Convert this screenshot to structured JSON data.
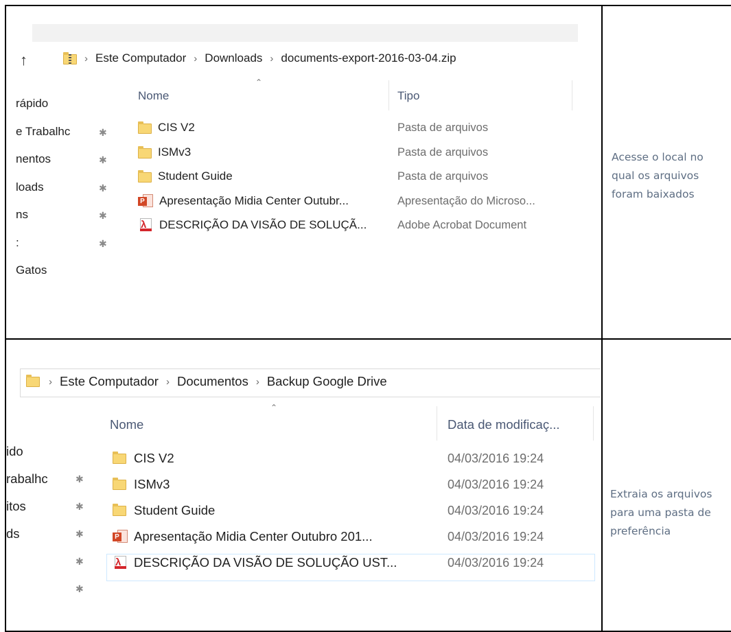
{
  "shot1": {
    "breadcrumb": [
      "Este Computador",
      "Downloads",
      "documents-export-2016-03-04.zip"
    ],
    "sep": "›",
    "columns": {
      "name": "Nome",
      "second": "Tipo"
    },
    "nav": [
      {
        "label": "rápido",
        "pinned": false
      },
      {
        "label": "e Trabalhc",
        "pinned": true
      },
      {
        "label": "nentos",
        "pinned": true
      },
      {
        "label": "loads",
        "pinned": true
      },
      {
        "label": "ns",
        "pinned": true
      },
      {
        "label": ":",
        "pinned": true
      },
      {
        "label": "Gatos",
        "pinned": false
      }
    ],
    "files": [
      {
        "icon": "folder-icon",
        "name": "CIS V2",
        "second": "Pasta de arquivos"
      },
      {
        "icon": "folder-icon",
        "name": "ISMv3",
        "second": "Pasta de arquivos"
      },
      {
        "icon": "folder-icon",
        "name": "Student Guide",
        "second": "Pasta de arquivos"
      },
      {
        "icon": "powerpoint-icon",
        "name": "Apresentação Midia Center Outubr...",
        "second": "Apresentação do Microso..."
      },
      {
        "icon": "pdf-icon",
        "name": "DESCRIÇÃO DA VISÃO DE SOLUÇÃ...",
        "second": "Adobe Acrobat Document"
      }
    ]
  },
  "caption1": [
    "Acesse o local no",
    "qual os arquivos",
    "foram baixados"
  ],
  "shot2": {
    "breadcrumb": [
      "Este Computador",
      "Documentos",
      "Backup Google Drive"
    ],
    "sep": "›",
    "columns": {
      "name": "Nome",
      "second": "Data de modificaç..."
    },
    "nav": [
      {
        "label": "ido",
        "pinned": false
      },
      {
        "label": "rabalhc",
        "pinned": true
      },
      {
        "label": "itos",
        "pinned": true
      },
      {
        "label": "ds",
        "pinned": true
      },
      {
        "label": "",
        "pinned": true
      },
      {
        "label": "",
        "pinned": true
      }
    ],
    "files": [
      {
        "icon": "folder-icon",
        "name": "CIS V2",
        "second": "04/03/2016 19:24"
      },
      {
        "icon": "folder-icon",
        "name": "ISMv3",
        "second": "04/03/2016 19:24"
      },
      {
        "icon": "folder-icon",
        "name": "Student Guide",
        "second": "04/03/2016 19:24"
      },
      {
        "icon": "powerpoint-icon",
        "name": "Apresentação Midia Center Outubro 201...",
        "second": "04/03/2016 19:24"
      },
      {
        "icon": "pdf-icon",
        "name": "DESCRIÇÃO DA VISÃO DE SOLUÇÃO UST...",
        "second": "04/03/2016 19:24"
      }
    ]
  },
  "caption2": [
    "Extraia os arquivos",
    "para uma pasta de",
    "preferência"
  ]
}
